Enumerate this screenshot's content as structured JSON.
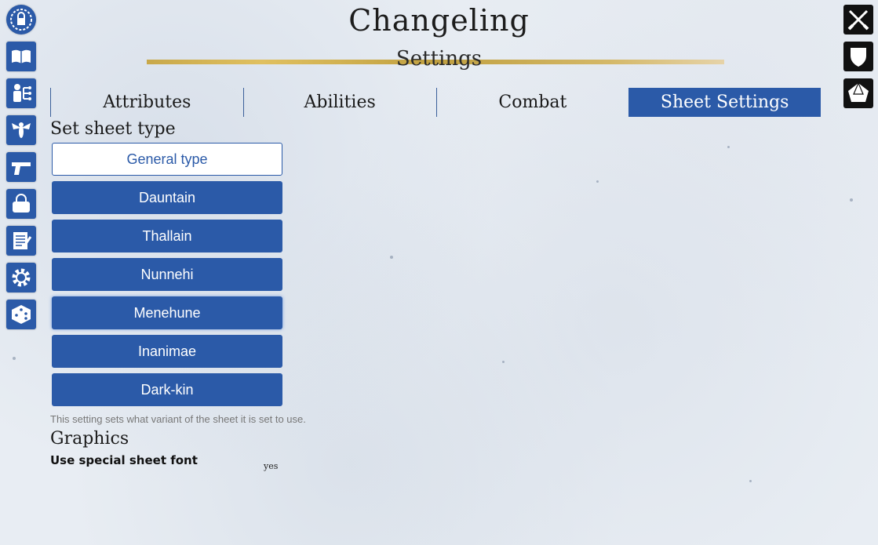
{
  "header": {
    "title": "Changeling",
    "subtitle": "Settings"
  },
  "left_sidebar": [
    {
      "name": "lock-icon"
    },
    {
      "name": "book-icon"
    },
    {
      "name": "person-tree-icon"
    },
    {
      "name": "wasp-icon"
    },
    {
      "name": "pistol-icon"
    },
    {
      "name": "bag-icon"
    },
    {
      "name": "notes-icon"
    },
    {
      "name": "gear-icon"
    },
    {
      "name": "dice-icon"
    }
  ],
  "right_sidebar": [
    {
      "name": "crossed-swords-icon"
    },
    {
      "name": "shield-icon"
    },
    {
      "name": "d10-dice-icon"
    }
  ],
  "tabs": [
    {
      "label": "Attributes",
      "active": false
    },
    {
      "label": "Abilities",
      "active": false
    },
    {
      "label": "Combat",
      "active": false
    },
    {
      "label": "Sheet Settings",
      "active": true
    }
  ],
  "sheet_type": {
    "heading": "Set sheet type",
    "options": [
      "General type",
      "Dauntain",
      "Thallain",
      "Nunnehi",
      "Menehune",
      "Inanimae",
      "Dark-kin"
    ],
    "selected": "General type",
    "hint": "This setting sets what variant of the sheet it is set to use."
  },
  "graphics": {
    "heading": "Graphics",
    "font_label": "Use special sheet font",
    "font_value": "yes"
  },
  "colors": {
    "accent": "#2b5aa8",
    "gold": "#c8a84a"
  }
}
